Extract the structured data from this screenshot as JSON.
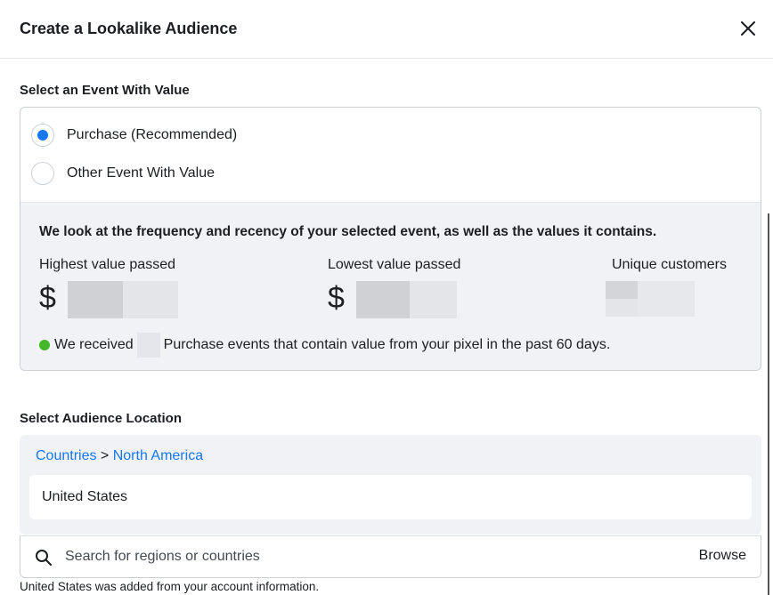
{
  "dialog": {
    "title": "Create a Lookalike Audience",
    "close_icon": "close-icon"
  },
  "event_section": {
    "label": "Select an Event With Value",
    "options": [
      {
        "label": "Purchase (Recommended)",
        "selected": true
      },
      {
        "label": "Other Event With Value",
        "selected": false
      }
    ],
    "info": {
      "heading": "We look at the frequency and recency of your selected event, as well as the values it contains.",
      "highest_label": "Highest value passed",
      "highest_currency": "$",
      "lowest_label": "Lowest value passed",
      "lowest_currency": "$",
      "unique_label": "Unique customers",
      "received_prefix": "We received",
      "received_suffix": "Purchase events that contain value from your pixel in the past 60 days.",
      "status_color": "#42b72a"
    }
  },
  "location_section": {
    "label": "Select Audience Location",
    "breadcrumb": {
      "root": "Countries",
      "separator": " > ",
      "current": "North America"
    },
    "selected": "United States",
    "search": {
      "placeholder": "Search for regions or countries",
      "browse_label": "Browse",
      "icon": "search-icon"
    },
    "footnote": "United States was added from your account information."
  },
  "colors": {
    "accent": "#1877f2",
    "panel": "#f0f2f5",
    "border": "#ccd0d5"
  }
}
